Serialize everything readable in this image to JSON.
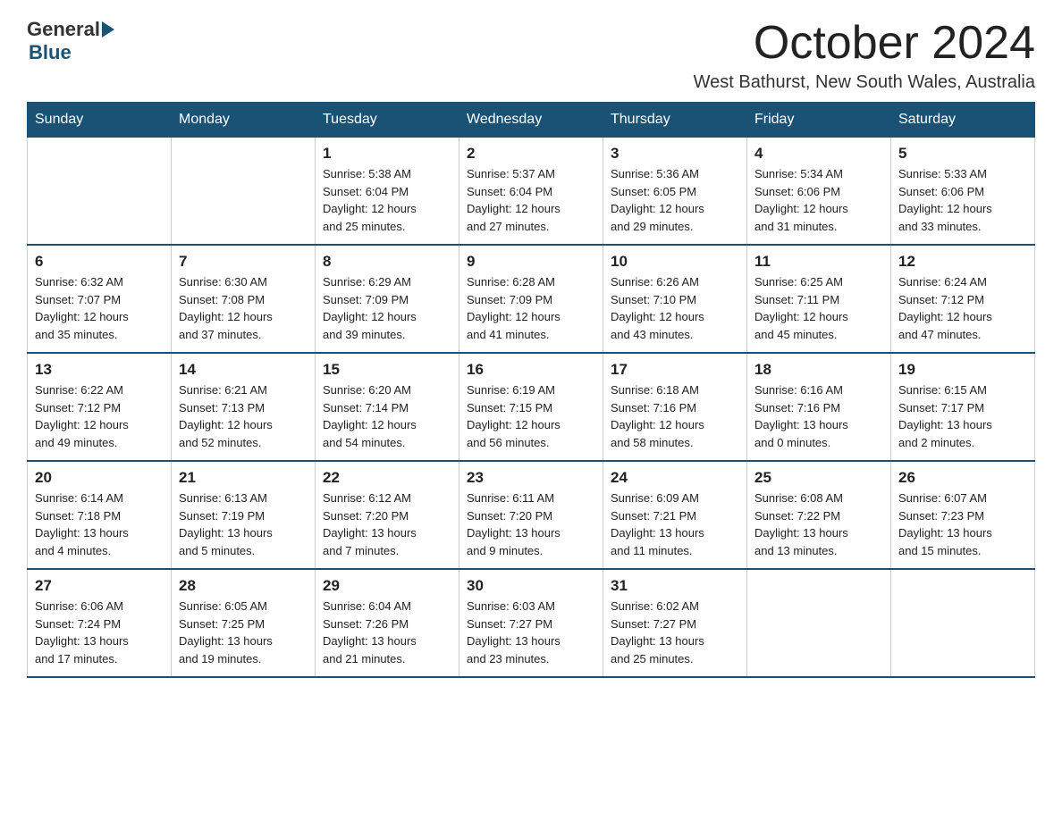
{
  "logo": {
    "general": "General",
    "blue": "Blue",
    "arrow_color": "#1a5276"
  },
  "title": {
    "month": "October 2024",
    "location": "West Bathurst, New South Wales, Australia"
  },
  "headers": [
    "Sunday",
    "Monday",
    "Tuesday",
    "Wednesday",
    "Thursday",
    "Friday",
    "Saturday"
  ],
  "weeks": [
    [
      {
        "day": "",
        "info": ""
      },
      {
        "day": "",
        "info": ""
      },
      {
        "day": "1",
        "info": "Sunrise: 5:38 AM\nSunset: 6:04 PM\nDaylight: 12 hours\nand 25 minutes."
      },
      {
        "day": "2",
        "info": "Sunrise: 5:37 AM\nSunset: 6:04 PM\nDaylight: 12 hours\nand 27 minutes."
      },
      {
        "day": "3",
        "info": "Sunrise: 5:36 AM\nSunset: 6:05 PM\nDaylight: 12 hours\nand 29 minutes."
      },
      {
        "day": "4",
        "info": "Sunrise: 5:34 AM\nSunset: 6:06 PM\nDaylight: 12 hours\nand 31 minutes."
      },
      {
        "day": "5",
        "info": "Sunrise: 5:33 AM\nSunset: 6:06 PM\nDaylight: 12 hours\nand 33 minutes."
      }
    ],
    [
      {
        "day": "6",
        "info": "Sunrise: 6:32 AM\nSunset: 7:07 PM\nDaylight: 12 hours\nand 35 minutes."
      },
      {
        "day": "7",
        "info": "Sunrise: 6:30 AM\nSunset: 7:08 PM\nDaylight: 12 hours\nand 37 minutes."
      },
      {
        "day": "8",
        "info": "Sunrise: 6:29 AM\nSunset: 7:09 PM\nDaylight: 12 hours\nand 39 minutes."
      },
      {
        "day": "9",
        "info": "Sunrise: 6:28 AM\nSunset: 7:09 PM\nDaylight: 12 hours\nand 41 minutes."
      },
      {
        "day": "10",
        "info": "Sunrise: 6:26 AM\nSunset: 7:10 PM\nDaylight: 12 hours\nand 43 minutes."
      },
      {
        "day": "11",
        "info": "Sunrise: 6:25 AM\nSunset: 7:11 PM\nDaylight: 12 hours\nand 45 minutes."
      },
      {
        "day": "12",
        "info": "Sunrise: 6:24 AM\nSunset: 7:12 PM\nDaylight: 12 hours\nand 47 minutes."
      }
    ],
    [
      {
        "day": "13",
        "info": "Sunrise: 6:22 AM\nSunset: 7:12 PM\nDaylight: 12 hours\nand 49 minutes."
      },
      {
        "day": "14",
        "info": "Sunrise: 6:21 AM\nSunset: 7:13 PM\nDaylight: 12 hours\nand 52 minutes."
      },
      {
        "day": "15",
        "info": "Sunrise: 6:20 AM\nSunset: 7:14 PM\nDaylight: 12 hours\nand 54 minutes."
      },
      {
        "day": "16",
        "info": "Sunrise: 6:19 AM\nSunset: 7:15 PM\nDaylight: 12 hours\nand 56 minutes."
      },
      {
        "day": "17",
        "info": "Sunrise: 6:18 AM\nSunset: 7:16 PM\nDaylight: 12 hours\nand 58 minutes."
      },
      {
        "day": "18",
        "info": "Sunrise: 6:16 AM\nSunset: 7:16 PM\nDaylight: 13 hours\nand 0 minutes."
      },
      {
        "day": "19",
        "info": "Sunrise: 6:15 AM\nSunset: 7:17 PM\nDaylight: 13 hours\nand 2 minutes."
      }
    ],
    [
      {
        "day": "20",
        "info": "Sunrise: 6:14 AM\nSunset: 7:18 PM\nDaylight: 13 hours\nand 4 minutes."
      },
      {
        "day": "21",
        "info": "Sunrise: 6:13 AM\nSunset: 7:19 PM\nDaylight: 13 hours\nand 5 minutes."
      },
      {
        "day": "22",
        "info": "Sunrise: 6:12 AM\nSunset: 7:20 PM\nDaylight: 13 hours\nand 7 minutes."
      },
      {
        "day": "23",
        "info": "Sunrise: 6:11 AM\nSunset: 7:20 PM\nDaylight: 13 hours\nand 9 minutes."
      },
      {
        "day": "24",
        "info": "Sunrise: 6:09 AM\nSunset: 7:21 PM\nDaylight: 13 hours\nand 11 minutes."
      },
      {
        "day": "25",
        "info": "Sunrise: 6:08 AM\nSunset: 7:22 PM\nDaylight: 13 hours\nand 13 minutes."
      },
      {
        "day": "26",
        "info": "Sunrise: 6:07 AM\nSunset: 7:23 PM\nDaylight: 13 hours\nand 15 minutes."
      }
    ],
    [
      {
        "day": "27",
        "info": "Sunrise: 6:06 AM\nSunset: 7:24 PM\nDaylight: 13 hours\nand 17 minutes."
      },
      {
        "day": "28",
        "info": "Sunrise: 6:05 AM\nSunset: 7:25 PM\nDaylight: 13 hours\nand 19 minutes."
      },
      {
        "day": "29",
        "info": "Sunrise: 6:04 AM\nSunset: 7:26 PM\nDaylight: 13 hours\nand 21 minutes."
      },
      {
        "day": "30",
        "info": "Sunrise: 6:03 AM\nSunset: 7:27 PM\nDaylight: 13 hours\nand 23 minutes."
      },
      {
        "day": "31",
        "info": "Sunrise: 6:02 AM\nSunset: 7:27 PM\nDaylight: 13 hours\nand 25 minutes."
      },
      {
        "day": "",
        "info": ""
      },
      {
        "day": "",
        "info": ""
      }
    ]
  ]
}
